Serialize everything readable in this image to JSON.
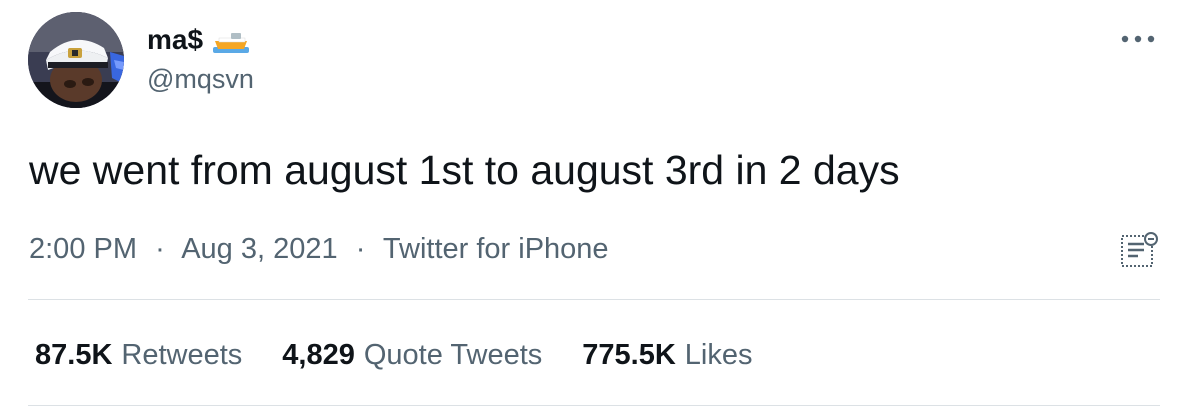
{
  "author": {
    "display_name": "ma$",
    "handle": "@mqsvn",
    "avatar_icon": "avatar-captain-hat",
    "name_emoji": "speedboat-emoji"
  },
  "tweet": {
    "text": "we went from august 1st to august 3rd in 2 days",
    "time": "2:00 PM",
    "date": "Aug 3, 2021",
    "separator": "·",
    "source": "Twitter for iPhone"
  },
  "stats": {
    "retweets": {
      "count": "87.5K",
      "label": "Retweets"
    },
    "quote_tweets": {
      "count": "4,829",
      "label": "Quote Tweets"
    },
    "likes": {
      "count": "775.5K",
      "label": "Likes"
    }
  },
  "icons": {
    "more": "more-horizontal-icon",
    "analytics": "analytics-icon"
  },
  "colors": {
    "text_primary": "#0f1419",
    "text_secondary": "#536471",
    "divider": "#dce1e5",
    "boat": "#f5a623",
    "boat_water": "#5aa9e6"
  }
}
